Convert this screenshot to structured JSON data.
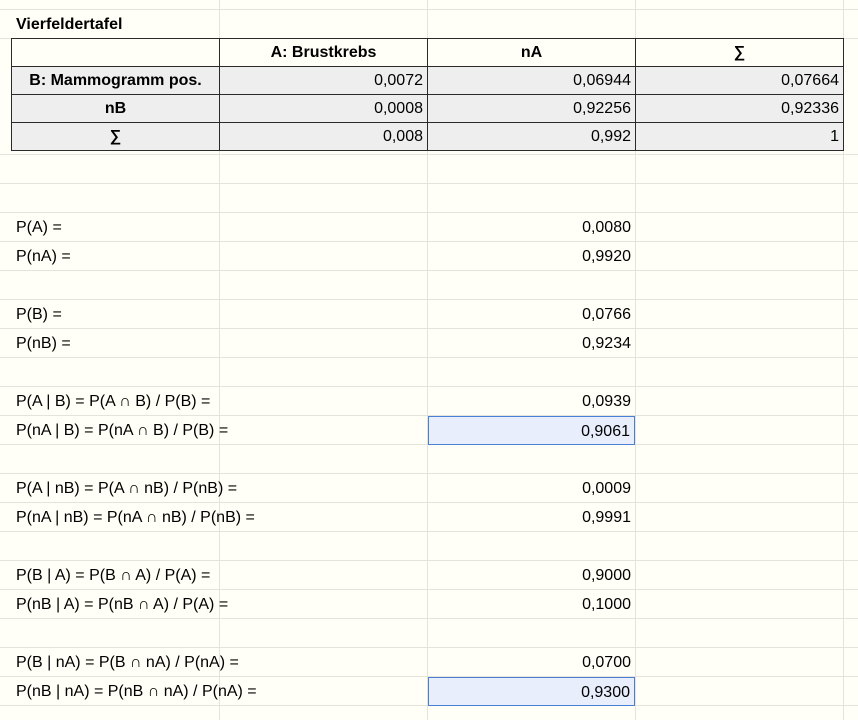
{
  "title": "Vierfeldertafel",
  "table": {
    "col_headers": [
      "A: Brustkrebs",
      "nA",
      "∑"
    ],
    "rows": [
      {
        "label": "B: Mammogramm pos.",
        "values": [
          "0,0072",
          "0,06944",
          "0,07664"
        ]
      },
      {
        "label": "nB",
        "values": [
          "0,0008",
          "0,92256",
          "0,92336"
        ]
      },
      {
        "label": "∑",
        "values": [
          "0,008",
          "0,992",
          "1"
        ]
      }
    ]
  },
  "probabilities": [
    {
      "label": "P(A) =",
      "value": "0,0080",
      "selected": false
    },
    {
      "label": "P(nA) =",
      "value": "0,9920",
      "selected": false
    },
    {
      "label": "P(B) =",
      "value": "0,0766",
      "selected": false
    },
    {
      "label": "P(nB) =",
      "value": "0,9234",
      "selected": false
    },
    {
      "label": "P(A | B) = P(A ∩ B) / P(B) =",
      "value": "0,0939",
      "selected": false
    },
    {
      "label": "P(nA | B) = P(nA ∩ B) / P(B) =",
      "value": "0,9061",
      "selected": true
    },
    {
      "label": "P(A | nB) = P(A ∩ nB) / P(nB) =",
      "value": "0,0009",
      "selected": false
    },
    {
      "label": "P(nA | nB) = P(nA ∩ nB) / P(nB) =",
      "value": "0,9991",
      "selected": false
    },
    {
      "label": "P(B | A) = P(B ∩ A) / P(A) =",
      "value": "0,9000",
      "selected": false
    },
    {
      "label": "P(nB | A) = P(nB ∩ A) / P(A) =",
      "value": "0,1000",
      "selected": false
    },
    {
      "label": "P(B | nA) = P(B ∩ nA) / P(nA) =",
      "value": "0,0700",
      "selected": false
    },
    {
      "label": "P(nB | nA) = P(nB ∩ nA) / P(nA) =",
      "value": "0,9300",
      "selected": true
    }
  ],
  "colors": {
    "selection_fill": "#e8eefb",
    "selection_border": "#4a7fd6",
    "header_fill": "#eeeeee"
  }
}
